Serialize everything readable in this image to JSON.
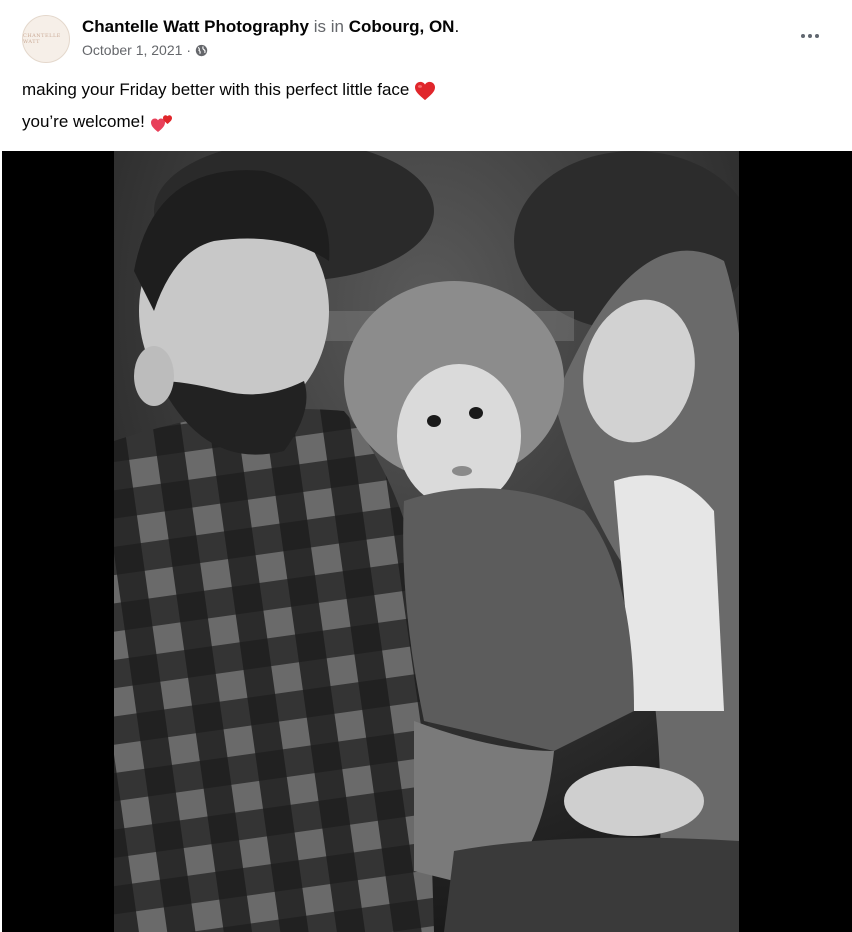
{
  "post": {
    "author": "Chantelle Watt Photography",
    "is_in_text": "is in",
    "location": "Cobourg, ON",
    "location_suffix": ".",
    "date": "October 1, 2021",
    "date_separator": "·",
    "privacy_icon": "globe-icon",
    "more_icon": "more-options-icon",
    "avatar_logo_text": "CHANTELLE WATT"
  },
  "caption": {
    "line1": "making your Friday better with this perfect little face",
    "line1_emoji": "heart-icon",
    "line2": "you’re welcome!",
    "line2_emoji": "two-hearts-icon"
  },
  "media": {
    "photo_icon": "family-portrait-photo",
    "style": "black-and-white"
  },
  "colors": {
    "text": "#050505",
    "secondary": "#65676b",
    "heart": "#e0262b",
    "media_bg": "#000000"
  }
}
